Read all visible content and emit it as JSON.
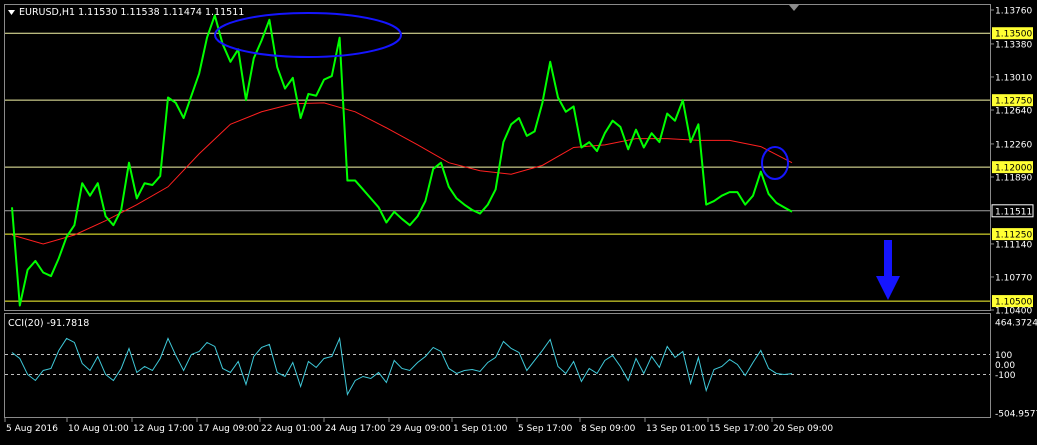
{
  "header": {
    "main_title": "EURUSD,H1  1.11530 1.11538 1.11474 1.11511",
    "indicator_title": "CCI(20) -91.7818"
  },
  "colors": {
    "background": "#000000",
    "price": "#00ff00",
    "moving_average": "#ff2020",
    "cci": "#3fc8d8",
    "level_line": "#ffff66",
    "annotation": "#1515ff",
    "axis": "#c8c8c8"
  },
  "chart_data": [
    {
      "type": "line",
      "name": "price-panel",
      "ylim": [
        1.104,
        1.1376
      ],
      "y_ticks": [
        "1.13760",
        "1.13380",
        "1.13010",
        "1.12640",
        "1.12260",
        "1.11890",
        "1.11140",
        "1.10770",
        "1.10400"
      ],
      "x_ticks": [
        "5 Aug 2016",
        "10 Aug 01:00",
        "12 Aug 17:00",
        "17 Aug 09:00",
        "22 Aug 01:00",
        "24 Aug 17:00",
        "29 Aug 09:00",
        "1 Sep 01:00",
        "5 Sep 17:00",
        "8 Sep 09:00",
        "13 Sep 01:00",
        "15 Sep 17:00",
        "20 Sep 09:00"
      ],
      "level_lines": [
        {
          "value": 1.135,
          "label": "1.13500",
          "style": "white"
        },
        {
          "value": 1.1275,
          "label": "1.12750",
          "style": "white"
        },
        {
          "value": 1.12,
          "label": "1.12000",
          "style": "white"
        },
        {
          "value": 1.1125,
          "label": "1.11250",
          "style": "yellow"
        },
        {
          "value": 1.105,
          "label": "1.10500",
          "style": "yellow"
        }
      ],
      "current_price": {
        "value": 1.11511,
        "label": "1.11511"
      },
      "series": [
        {
          "role": "price",
          "x": [
            0,
            3,
            6,
            9,
            12,
            15,
            18,
            21,
            24,
            27,
            30,
            33,
            36,
            39,
            42,
            45,
            48,
            51,
            54,
            57,
            60,
            63,
            66,
            69,
            72,
            75,
            78,
            81,
            84,
            87,
            90,
            93,
            96,
            99,
            102,
            105,
            108,
            111,
            114,
            117,
            120,
            123,
            126,
            129,
            132,
            135,
            138,
            141,
            144,
            147,
            150,
            153,
            156,
            159,
            162,
            165,
            168,
            171,
            174,
            177,
            180,
            183,
            186,
            189,
            192,
            195,
            198,
            201,
            204,
            207,
            210,
            213,
            216,
            219,
            222,
            225,
            228,
            231,
            234,
            237,
            240,
            243,
            246,
            249,
            252,
            255,
            258,
            261,
            264,
            267,
            270,
            273,
            276,
            279,
            282,
            285,
            288,
            291,
            294,
            297,
            300
          ],
          "y": [
            1.1155,
            1.1045,
            1.1085,
            1.1095,
            1.1082,
            1.1078,
            1.1098,
            1.1122,
            1.1135,
            1.1182,
            1.1168,
            1.1182,
            1.1145,
            1.1135,
            1.1152,
            1.1205,
            1.1165,
            1.1182,
            1.118,
            1.119,
            1.1278,
            1.1272,
            1.1255,
            1.128,
            1.1305,
            1.1345,
            1.137,
            1.1338,
            1.1318,
            1.1332,
            1.1275,
            1.1322,
            1.1342,
            1.1365,
            1.1312,
            1.1288,
            1.13,
            1.1255,
            1.1282,
            1.128,
            1.1298,
            1.1302,
            1.1345,
            1.1185,
            1.1185,
            1.1175,
            1.1165,
            1.1155,
            1.1138,
            1.115,
            1.1142,
            1.1135,
            1.1145,
            1.1162,
            1.1198,
            1.1205,
            1.1178,
            1.1165,
            1.1158,
            1.1152,
            1.1148,
            1.1158,
            1.1175,
            1.1228,
            1.1248,
            1.1255,
            1.1235,
            1.124,
            1.1272,
            1.1318,
            1.1278,
            1.1262,
            1.1268,
            1.1222,
            1.1228,
            1.1218,
            1.1238,
            1.1252,
            1.1245,
            1.122,
            1.1242,
            1.1222,
            1.1238,
            1.1228,
            1.126,
            1.1252,
            1.1275,
            1.1228,
            1.1248,
            1.1158,
            1.1162,
            1.1168,
            1.1172,
            1.1172,
            1.1158,
            1.1168,
            1.1195,
            1.117,
            1.116,
            1.1155,
            1.115
          ]
        },
        {
          "role": "moving_average",
          "x": [
            0,
            12,
            24,
            36,
            48,
            60,
            72,
            84,
            96,
            108,
            120,
            132,
            144,
            156,
            168,
            180,
            192,
            204,
            216,
            228,
            240,
            252,
            264,
            276,
            288,
            300
          ],
          "y": [
            1.1124,
            1.1114,
            1.1124,
            1.114,
            1.1158,
            1.1178,
            1.1215,
            1.1248,
            1.1262,
            1.1271,
            1.1272,
            1.1262,
            1.1244,
            1.1225,
            1.1205,
            1.1196,
            1.1192,
            1.1202,
            1.1222,
            1.1225,
            1.1232,
            1.1232,
            1.123,
            1.123,
            1.1223,
            1.1205
          ]
        }
      ]
    },
    {
      "type": "line",
      "name": "cci-panel",
      "ylim": [
        -504.9577,
        464.3724
      ],
      "y_ticks": [
        "464.3724",
        "100",
        "0.00",
        "-100",
        "-504.9577"
      ],
      "levels": [
        100,
        -100
      ],
      "series": [
        {
          "role": "cci",
          "x": [
            0,
            3,
            6,
            9,
            12,
            15,
            18,
            21,
            24,
            27,
            30,
            33,
            36,
            39,
            42,
            45,
            48,
            51,
            54,
            57,
            60,
            63,
            66,
            69,
            72,
            75,
            78,
            81,
            84,
            87,
            90,
            93,
            96,
            99,
            102,
            105,
            108,
            111,
            114,
            117,
            120,
            123,
            126,
            129,
            132,
            135,
            138,
            141,
            144,
            147,
            150,
            153,
            156,
            159,
            162,
            165,
            168,
            171,
            174,
            177,
            180,
            183,
            186,
            189,
            192,
            195,
            198,
            201,
            204,
            207,
            210,
            213,
            216,
            219,
            222,
            225,
            228,
            231,
            234,
            237,
            240,
            243,
            246,
            249,
            252,
            255,
            258,
            261,
            264,
            267,
            270,
            273,
            276,
            279,
            282,
            285,
            288,
            291,
            294,
            297,
            300
          ],
          "y": [
            120,
            60,
            -100,
            -160,
            -60,
            -40,
            140,
            260,
            220,
            10,
            -60,
            80,
            -100,
            -160,
            -40,
            160,
            -80,
            -20,
            -60,
            60,
            260,
            90,
            -60,
            100,
            130,
            220,
            180,
            -40,
            -80,
            30,
            -200,
            80,
            170,
            200,
            -80,
            -120,
            20,
            -220,
            30,
            -30,
            60,
            80,
            260,
            -300,
            -160,
            -120,
            -140,
            -80,
            -180,
            40,
            -40,
            -60,
            20,
            80,
            170,
            130,
            -40,
            -90,
            -60,
            -50,
            -70,
            20,
            70,
            230,
            160,
            120,
            -60,
            40,
            140,
            250,
            -20,
            -90,
            30,
            -170,
            -40,
            -90,
            40,
            90,
            -20,
            -160,
            60,
            -90,
            80,
            -30,
            180,
            70,
            130,
            -190,
            70,
            -260,
            -50,
            -20,
            50,
            0,
            -110,
            20,
            140,
            -40,
            -90,
            -100,
            -92
          ]
        }
      ]
    }
  ],
  "annotations": {
    "arrow": "down-arrow",
    "ellipses": [
      "resistance-zone-ellipse",
      "price-touch-ellipse"
    ]
  }
}
